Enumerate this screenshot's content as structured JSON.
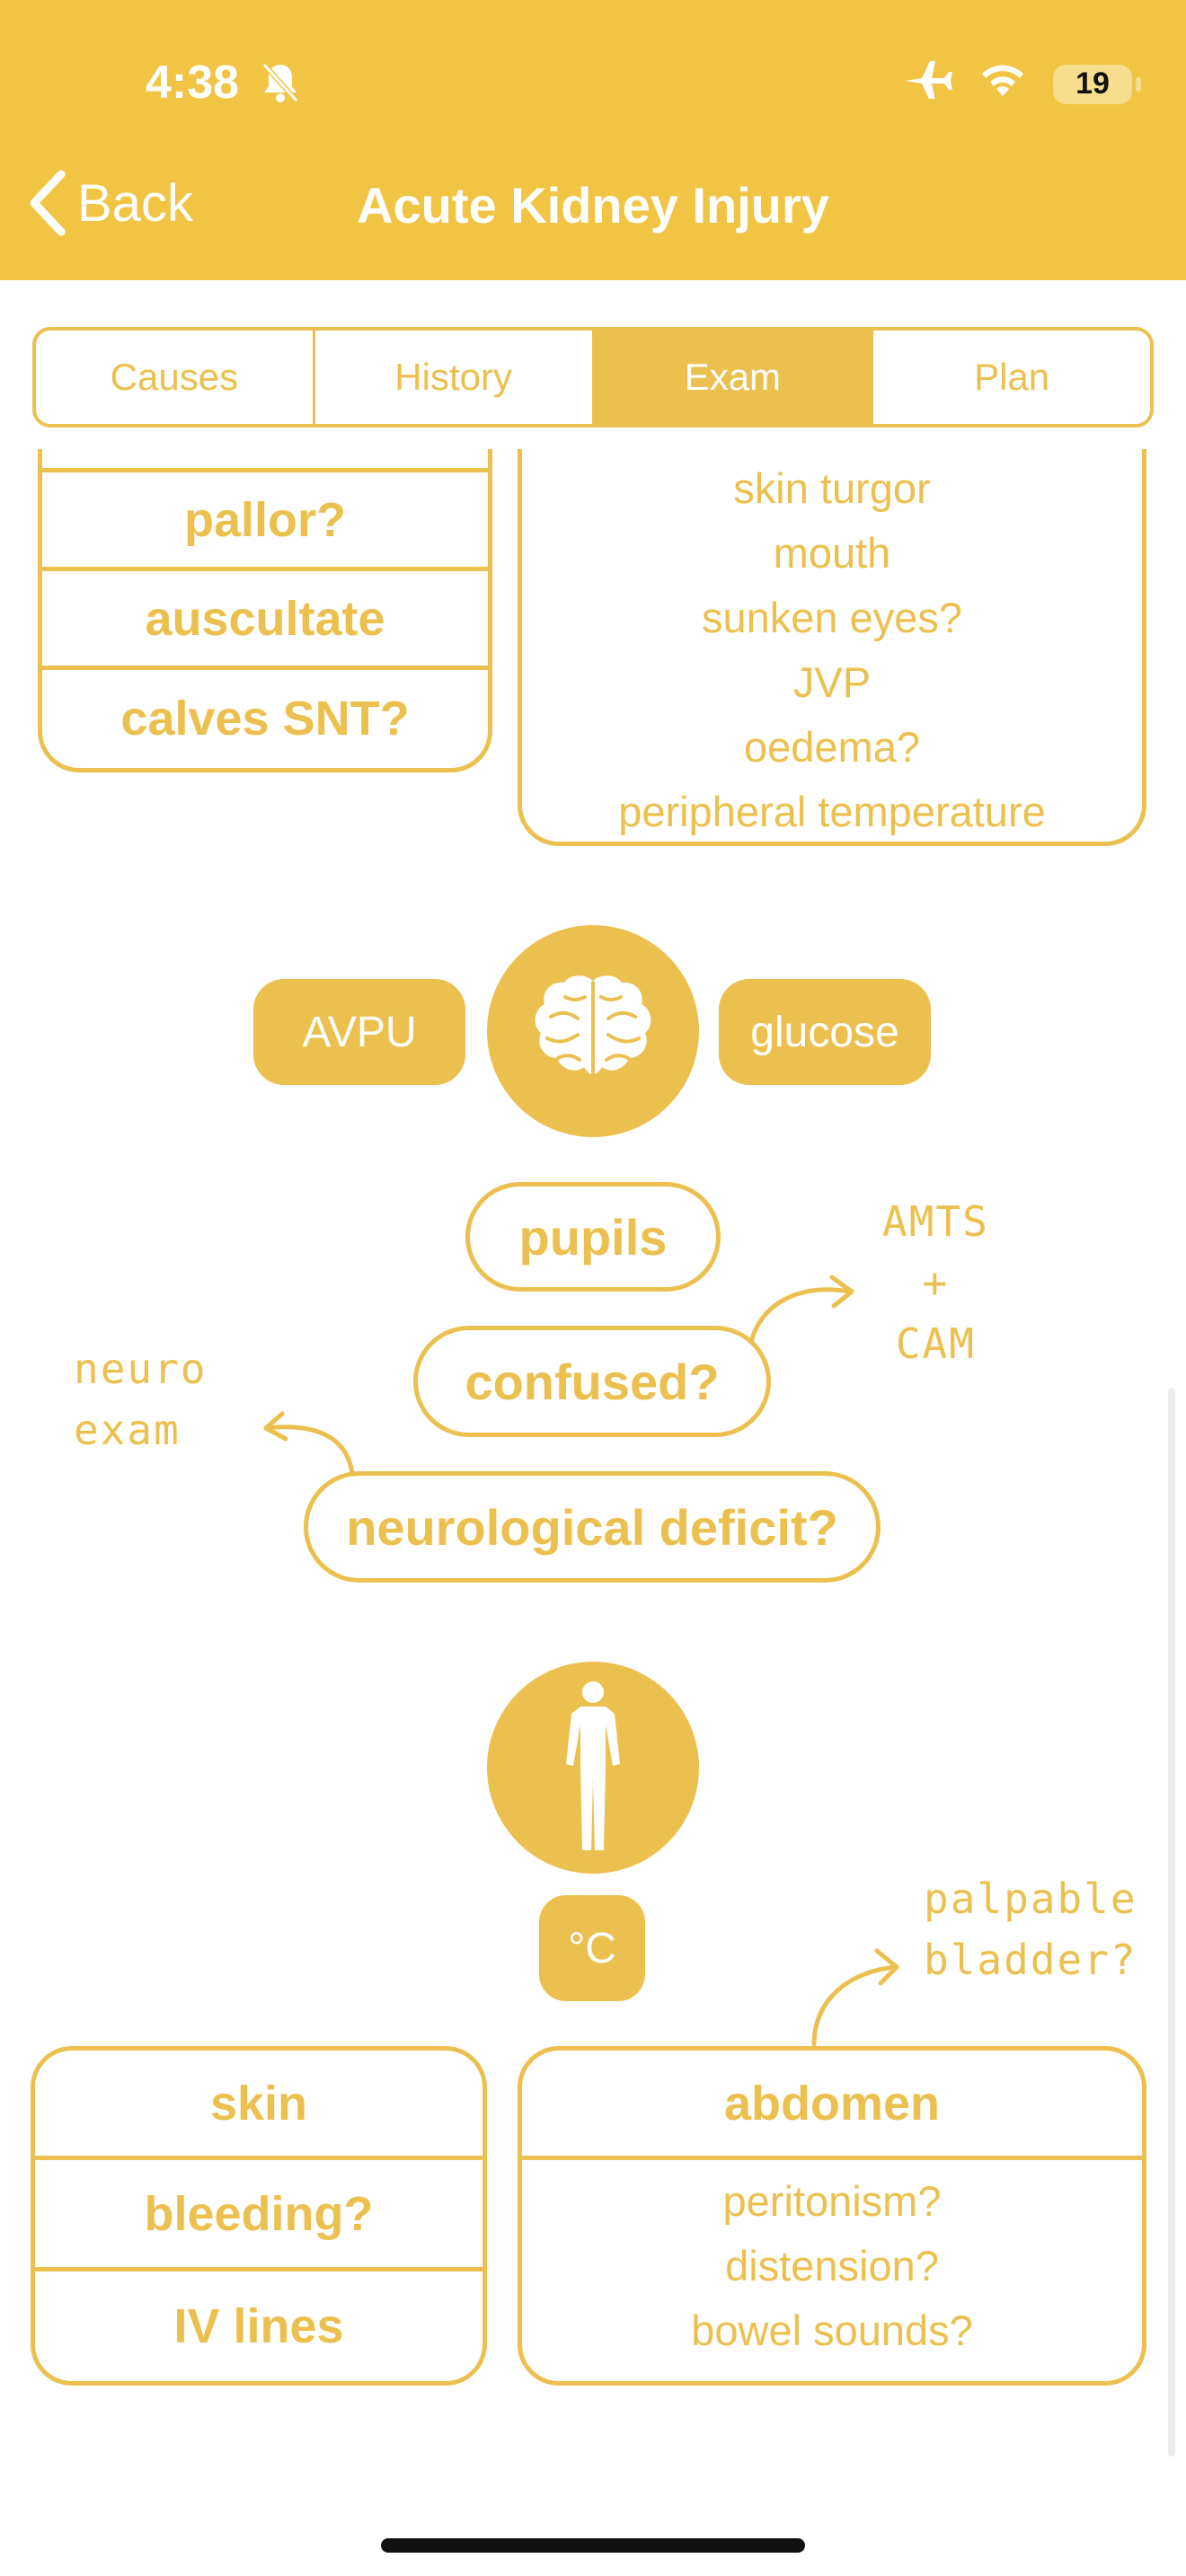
{
  "status": {
    "time": "4:38",
    "battery": "19"
  },
  "nav": {
    "back_label": "Back",
    "title": "Acute Kidney Injury"
  },
  "tabs": [
    {
      "label": "Causes",
      "active": false
    },
    {
      "label": "History",
      "active": false
    },
    {
      "label": "Exam",
      "active": true
    },
    {
      "label": "Plan",
      "active": false
    }
  ],
  "upper_left_box": {
    "rows": [
      "pallor?",
      "auscultate",
      "calves SNT?"
    ]
  },
  "upper_right_box": {
    "items": [
      "skin turgor",
      "mouth",
      "sunken eyes?",
      "JVP",
      "oedema?",
      "peripheral temperature"
    ]
  },
  "neuro": {
    "avpu_label": "AVPU",
    "glucose_label": "glucose",
    "pupils_label": "pupils",
    "confused_label": "confused?",
    "deficit_label": "neurological deficit?",
    "note_neuro_line1": "neuro",
    "note_neuro_line2": "exam",
    "note_amts_line1": "AMTS",
    "note_amts_line2": "+",
    "note_amts_line3": "CAM"
  },
  "body": {
    "temp_label": "°C",
    "note_bladder_line1": "palpable",
    "note_bladder_line2": "bladder?"
  },
  "skin_box": {
    "rows": [
      "skin",
      "bleeding?",
      "IV lines"
    ]
  },
  "abdomen_box": {
    "title": "abdomen",
    "items": [
      "peritonism?",
      "distension?",
      "bowel sounds?"
    ]
  },
  "colors": {
    "accent": "#ECC04F",
    "header": "#F2C443"
  },
  "icons": [
    "airplane-icon",
    "wifi-icon",
    "silent-bell-icon",
    "brain-icon",
    "human-figure-icon",
    "chevron-left-icon"
  ]
}
